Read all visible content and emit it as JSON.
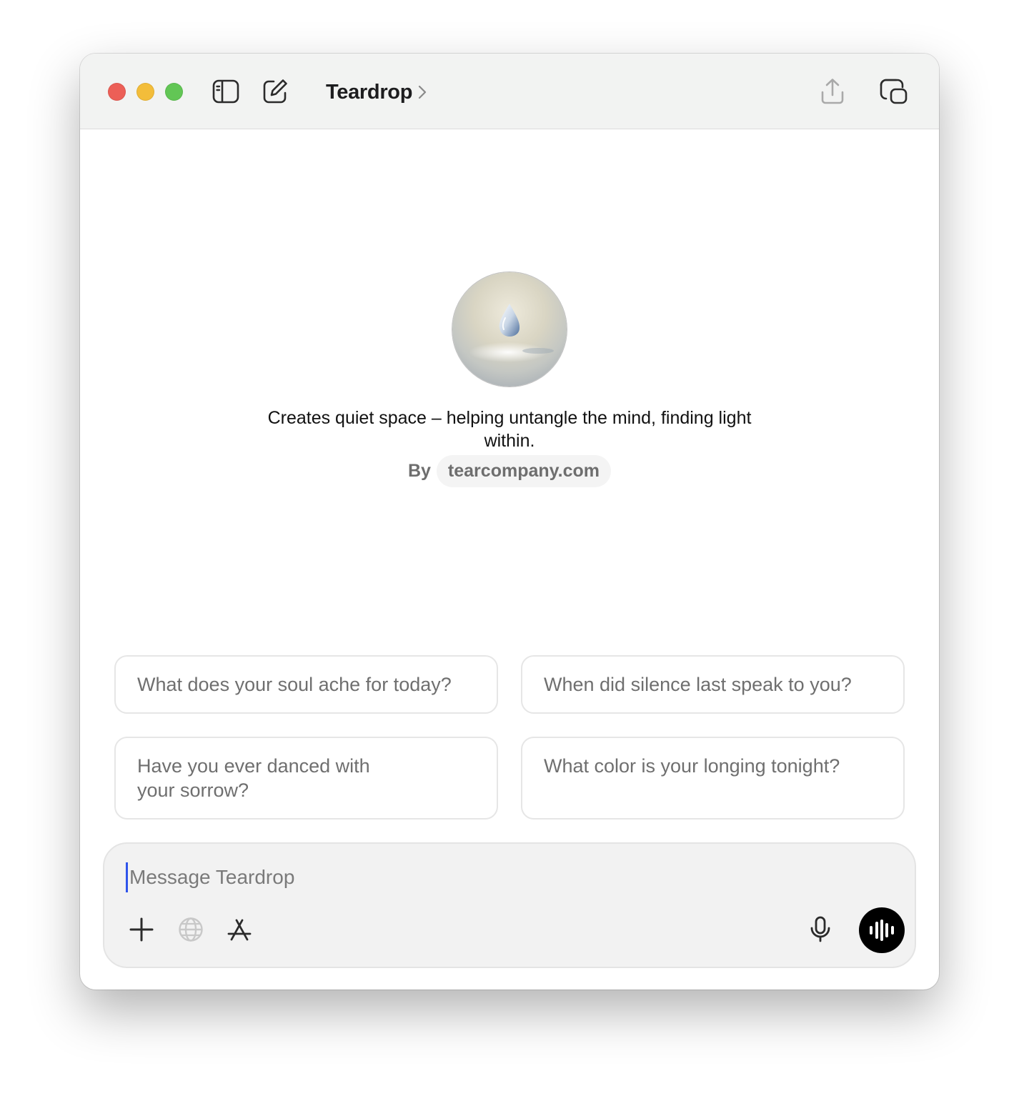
{
  "window": {
    "title": "Teardrop",
    "icons": {
      "sidebar": "sidebar-toggle-icon",
      "compose": "new-chat-icon",
      "chevron": "chevron-right-icon",
      "share": "share-icon",
      "window": "new-window-icon"
    }
  },
  "profile": {
    "avatar": "teardrop-avatar",
    "description": "Creates quiet space – helping untangle the mind, finding light within.",
    "by_label": "By",
    "author": "tearcompany.com"
  },
  "suggestions": [
    "What does your soul ache for today?",
    "When did silence last speak to you?",
    "Have you ever danced with your sorrow?",
    "What color is your longing tonight?"
  ],
  "composer": {
    "placeholder": "Message Teardrop",
    "value": "",
    "icons": {
      "attach": "plus-icon",
      "web": "globe-icon",
      "tools": "app-store-icon",
      "dictate": "microphone-icon",
      "voice": "voice-waveform-icon"
    }
  },
  "colors": {
    "close": "#ec5f57",
    "minimize": "#f3bd3a",
    "maximize": "#62c655",
    "titlebar": "#f2f3f2",
    "composer_bg": "#f2f2f2",
    "voice_button": "#000000",
    "caret": "#2f54eb"
  }
}
